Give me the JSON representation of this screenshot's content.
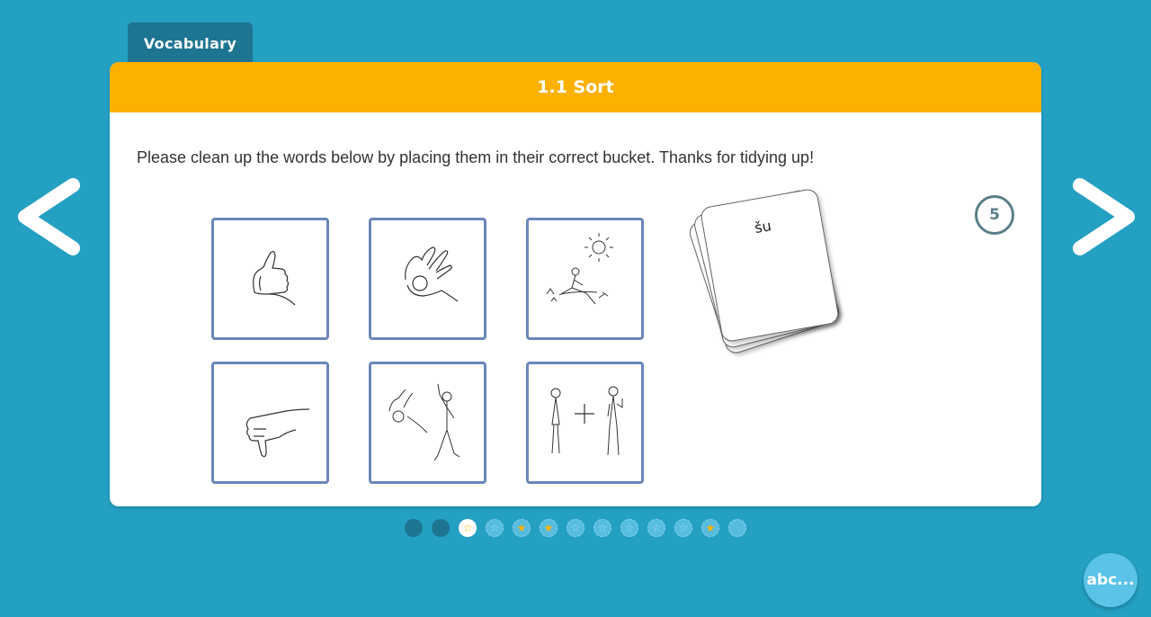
{
  "tab": {
    "label": "Vocabulary"
  },
  "activity": {
    "title": "1.1 Sort",
    "instructions": "Please clean up the words below by placing them in their correct bucket. Thanks for tidying up!"
  },
  "buckets": [
    {
      "icon": "thumbs-up-icon"
    },
    {
      "icon": "ok-hand-icon"
    },
    {
      "icon": "sunny-park-icon"
    },
    {
      "icon": "thumbs-down-icon"
    },
    {
      "icon": "ok-walking-man-icon"
    },
    {
      "icon": "woman-plus-man-icon"
    }
  ],
  "card": {
    "word": "šu"
  },
  "counter": {
    "value": "5"
  },
  "progress": {
    "dots": [
      "done",
      "done",
      "current",
      "empty",
      "star",
      "star",
      "empty",
      "empty",
      "empty",
      "empty",
      "empty",
      "star",
      "empty-plain"
    ]
  },
  "glossary_button": {
    "label": "abc..."
  },
  "colors": {
    "background": "#24a0c3",
    "header": "#fcb100",
    "tab": "#1e7592",
    "bucket_border": "#6a87bb"
  }
}
